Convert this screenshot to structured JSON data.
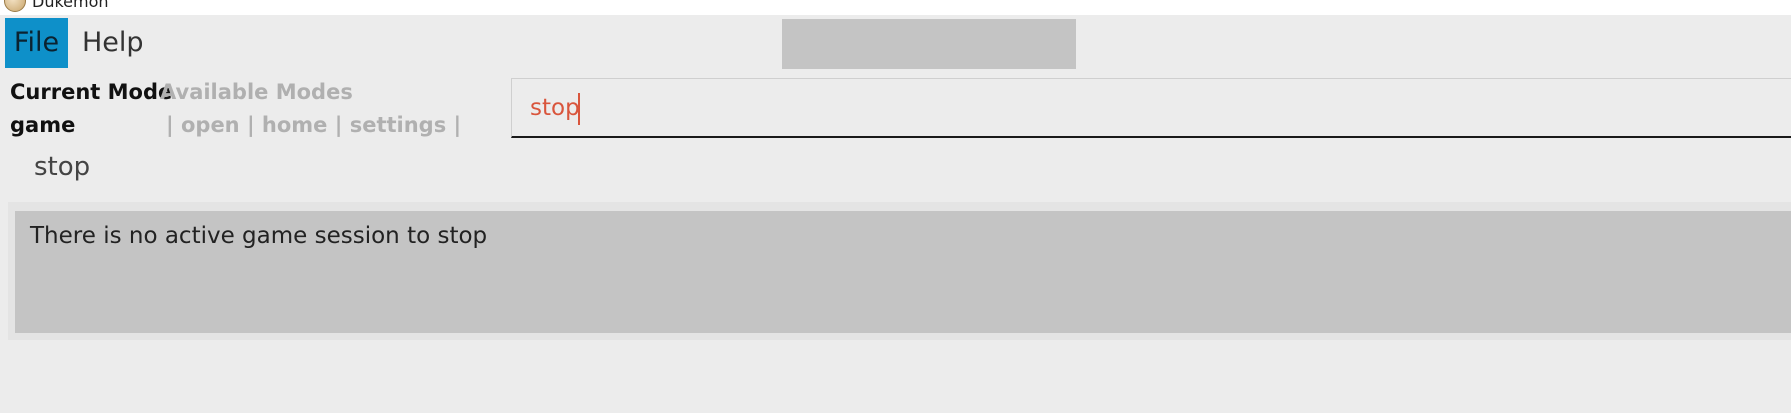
{
  "window": {
    "title": "Dukemon",
    "icon": "app-logo-icon"
  },
  "menu": {
    "file_label": "File",
    "help_label": "Help",
    "accent_color": "#0e90c9"
  },
  "mode_panel": {
    "current_mode_heading": "Current Mode",
    "current_mode_value": "game",
    "available_modes_heading": "Available Modes",
    "available_modes_text": "| open | home | settings |"
  },
  "command_box": {
    "value": "stop",
    "text_color": "#d9553c"
  },
  "echo": {
    "text": "stop"
  },
  "result": {
    "message": "There is no active game session to stop"
  }
}
